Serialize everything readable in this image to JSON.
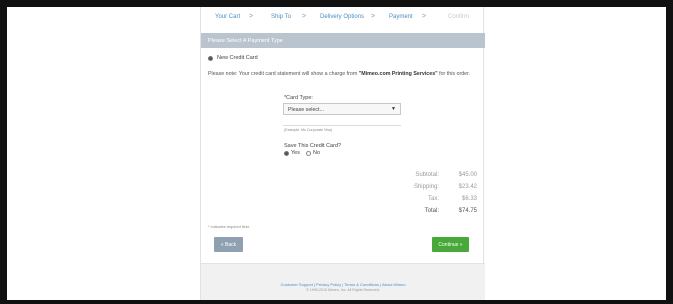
{
  "steps": [
    {
      "label": "Your Cart",
      "active": true
    },
    {
      "label": "Ship To",
      "active": true
    },
    {
      "label": "Delivery Options",
      "active": true
    },
    {
      "label": "Payment",
      "active": true
    },
    {
      "label": "Confirm",
      "active": false
    }
  ],
  "step_separator": ">",
  "section_title": "Please Select A Payment Type",
  "payment_option": "New Credit Card",
  "note_prefix": "Please note: Your credit card statement will show a charge from ",
  "note_merchant": "\"Mimeo.com Printing Services\"",
  "note_suffix": " for this order.",
  "card_type_label": "*Card Type:",
  "card_type_select": "Please select...",
  "card_example": "(Example: Ms Corporate Visa)",
  "save_card_label": "Save This Credit Card?",
  "save_yes": "Yes",
  "save_no": "No",
  "totals": [
    {
      "label": "Subtotal:",
      "value": "$45.00"
    },
    {
      "label": "Shipping:",
      "value": "$23.42"
    },
    {
      "label": "Tax:",
      "value": "$6.33"
    },
    {
      "label": "Total:",
      "value": "$74.75"
    }
  ],
  "required_note": "* Indicates required field.",
  "back_label": "« Back",
  "continue_label": "Continue »",
  "footer_links": "Customer Support | Privacy Policy | Terms & Conditions | About Mimeo",
  "footer_copyright": "© 1999-2015 Mimeo, Inc. All Rights Reserved.",
  "colors": {
    "frame": "#111111",
    "link": "#4a8ec4",
    "section_bar": "#b9c4cf",
    "back_button": "#8fa0b1",
    "continue_button": "#49a83a"
  }
}
